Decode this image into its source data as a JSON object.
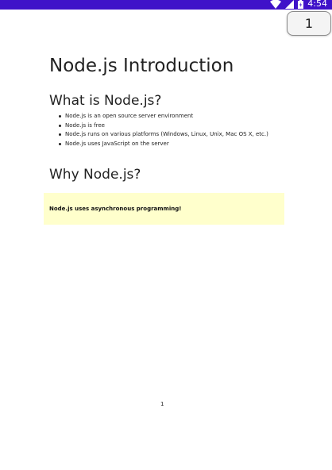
{
  "status_bar": {
    "time": "4:54",
    "icons": [
      "wifi-icon",
      "signal-icon",
      "battery-icon"
    ]
  },
  "page_button": {
    "label": "1"
  },
  "document": {
    "title": "Node.js Introduction",
    "section1_heading": "What is Node.js?",
    "bullets": [
      "Node.js is an open source server environment",
      "Node.js is free",
      "Node.js runs on various platforms (Windows, Linux, Unix, Mac OS X, etc.)",
      "Node.js uses JavaScript on the server"
    ],
    "section2_heading": "Why Node.js?",
    "note": "Node.js uses asynchronous programming!",
    "page_number": "1"
  },
  "colors": {
    "status_bar": "#3f12c9",
    "note_background": "#ffffcc"
  }
}
